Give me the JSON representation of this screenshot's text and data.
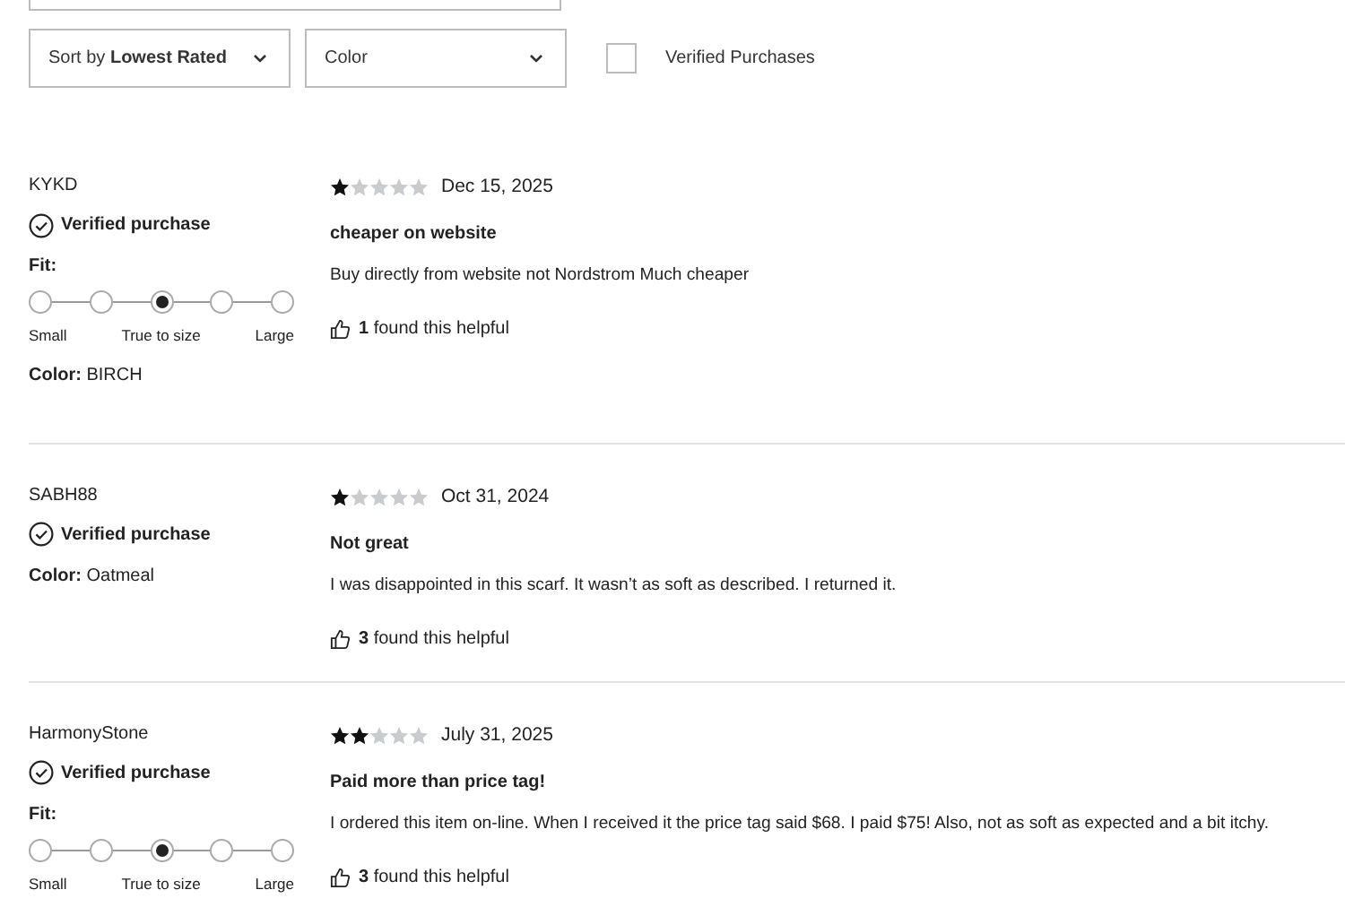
{
  "filters": {
    "sort": "Sort by **Lowest Rated**",
    "color_filter": "Color",
    "verified": {
      "label": "Verified Purchases",
      "checked": false
    }
  },
  "reviews": [
    {
      "author": "KYKD",
      "verified": "Verified purchase",
      "fit": {
        "label": "Fit:",
        "points": [
          {
            "selected": false
          },
          {
            "selected": false
          },
          {
            "selected": true
          },
          {
            "selected": false
          },
          {
            "selected": false
          }
        ],
        "low": "Small",
        "mid": "True to size",
        "high": "Large"
      },
      "color_label": "**Color:** BIRCH",
      "stars": 1,
      "date": "Dec 15, 2025",
      "title": "cheaper on website",
      "body": "Buy directly from website not Nordstrom Much cheaper",
      "helpful": "**1** found this helpful"
    },
    {
      "author": "SABH88",
      "verified": "Verified purchase",
      "color_label": "**Color:** Oatmeal",
      "stars": 1,
      "date": "Oct 31, 2024",
      "title": "Not great",
      "body": "I was disappointed in this scarf. It wasn’t as soft as described. I returned it.",
      "helpful": "**3** found this helpful"
    },
    {
      "author": "HarmonyStone",
      "verified": "Verified purchase",
      "fit": {
        "label": "Fit:",
        "points": [
          {
            "selected": false
          },
          {
            "selected": false
          },
          {
            "selected": true
          },
          {
            "selected": false
          },
          {
            "selected": false
          }
        ],
        "low": "Small",
        "mid": "True to size",
        "high": "Large"
      },
      "stars": 2,
      "date": "July 31, 2025",
      "title": "Paid more than price tag!",
      "body": "I ordered this item on-line. When I received it the price tag said $68. I paid $75! Also, not as soft as expected and a bit itchy.",
      "helpful": "**3** found this helpful"
    }
  ]
}
